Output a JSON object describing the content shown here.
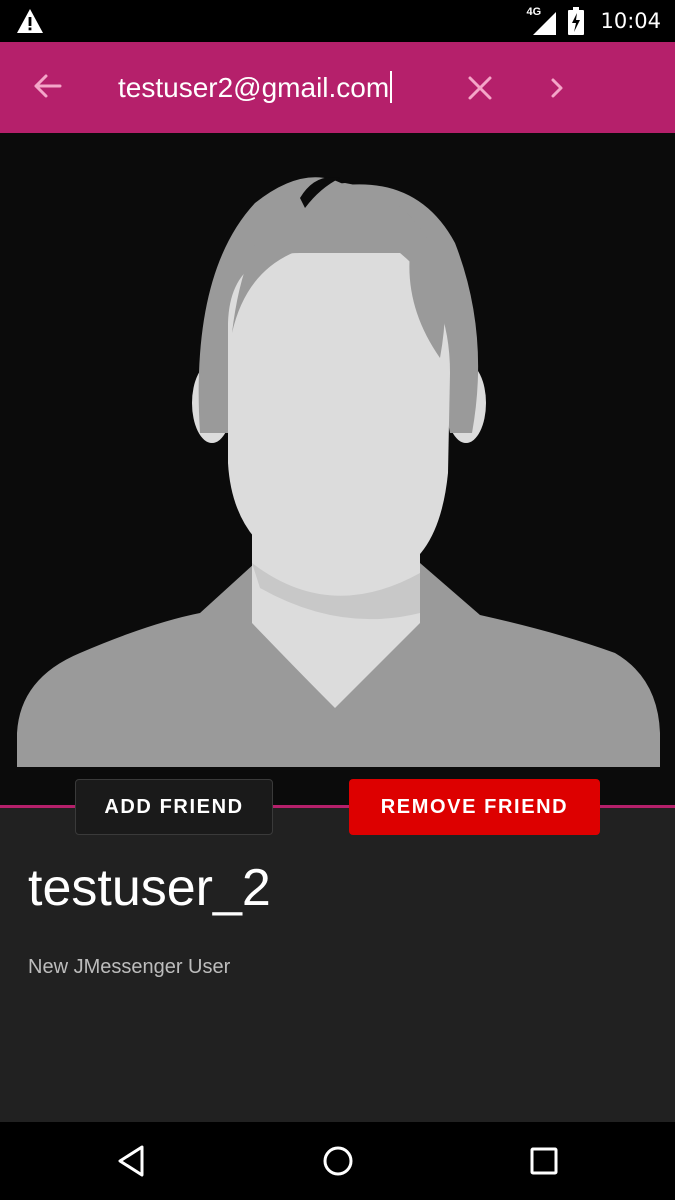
{
  "status_bar": {
    "alert_icon": "warning-icon",
    "network": "4G",
    "signal_icon": "signal-icon",
    "battery_icon": "battery-charging-icon",
    "time": "10:04"
  },
  "toolbar": {
    "back_icon": "arrow-back-icon",
    "search_value": "testuser2@gmail.com",
    "clear_icon": "close-icon",
    "next_icon": "chevron-right-icon",
    "color": "#b5206b"
  },
  "avatar": {
    "icon": "default-person-avatar"
  },
  "actions": {
    "add_friend_label": "ADD FRIEND",
    "remove_friend_label": "REMOVE FRIEND",
    "remove_color": "#dd0000"
  },
  "profile": {
    "username": "testuser_2",
    "status": "New JMessenger User"
  },
  "nav_bar": {
    "back_icon": "nav-back-icon",
    "home_icon": "nav-home-icon",
    "recents_icon": "nav-recents-icon"
  }
}
